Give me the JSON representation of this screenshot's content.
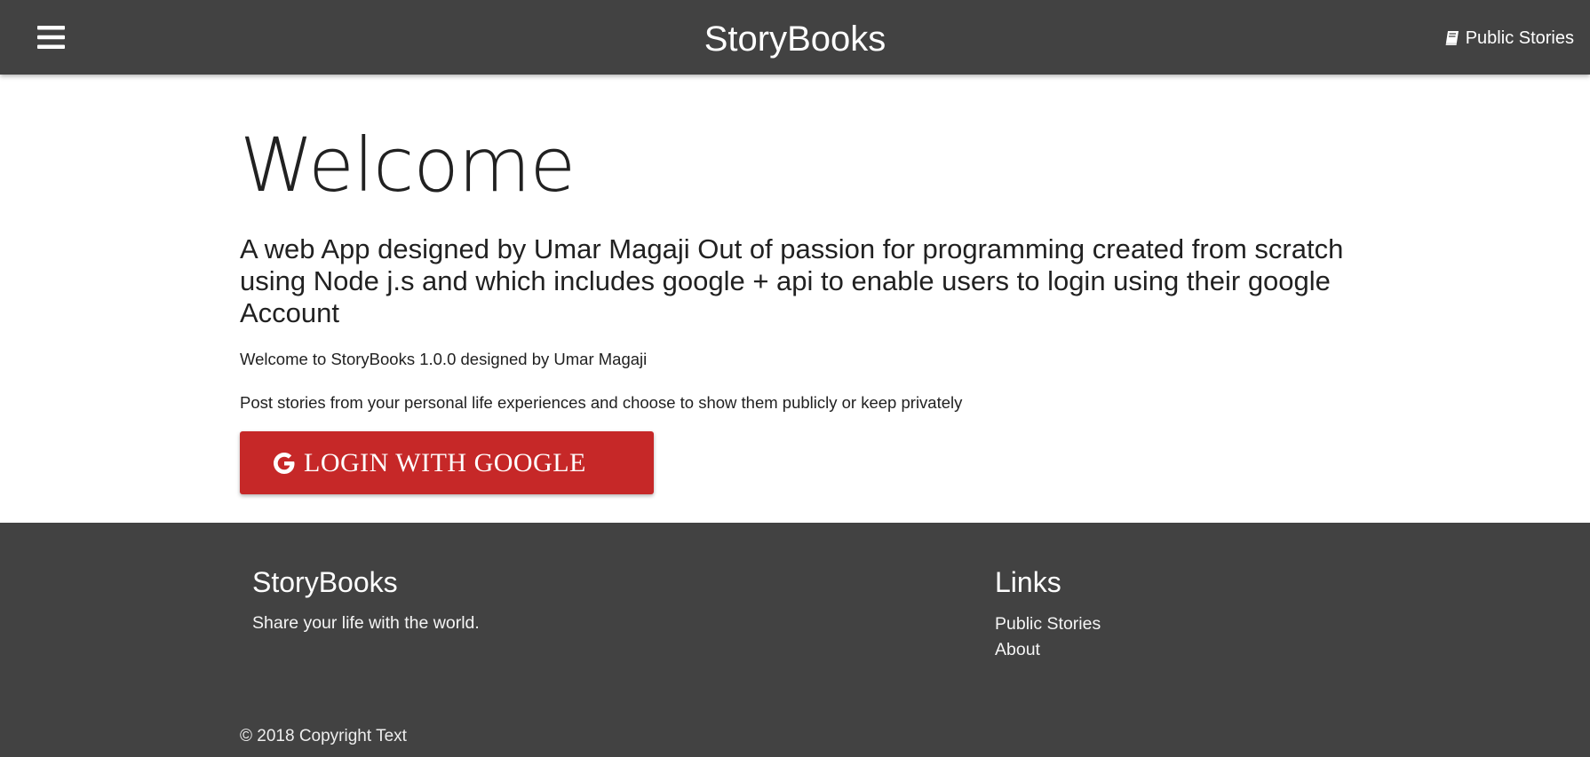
{
  "navbar": {
    "menu_icon": "hamburger-menu-icon",
    "brand": "StoryBooks",
    "public_stories_icon": "book-icon",
    "public_stories_label": "Public Stories"
  },
  "main": {
    "title": "Welcome",
    "lead": "A web App designed by Umar Magaji Out of passion for programming created from scratch using Node j.s and which includes google + api to enable users to login using their google Account",
    "info_1": "Welcome to StoryBooks 1.0.0 designed by Umar Magaji",
    "info_2": "Post stories from your personal life experiences and choose to show them publicly or keep privately",
    "login_icon": "google-icon",
    "login_label": "LOGIN WITH GOOGLE",
    "login_color": "#c62828"
  },
  "footer": {
    "brand_heading": "StoryBooks",
    "tagline": "Share your life with the world.",
    "links_heading": "Links",
    "links": [
      "Public Stories",
      "About"
    ],
    "copyright": "© 2018 Copyright Text",
    "background": "#424242"
  }
}
